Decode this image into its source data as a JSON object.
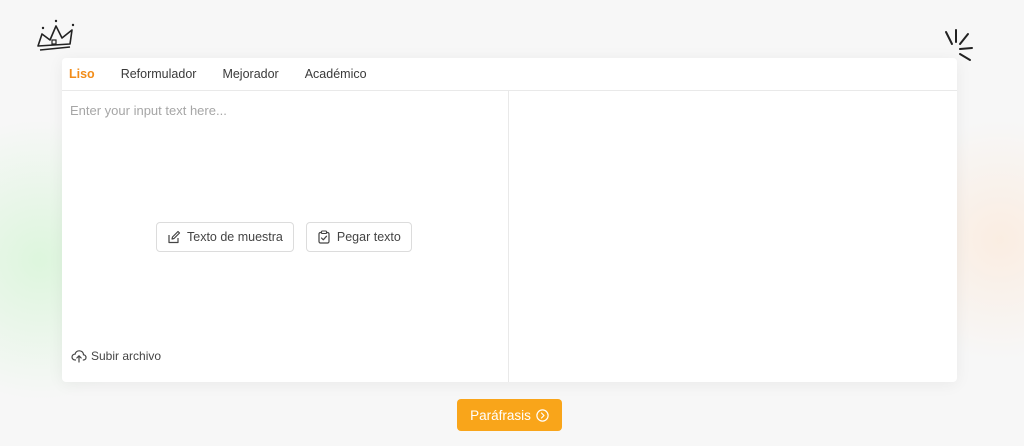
{
  "tabs": [
    {
      "label": "Liso",
      "active": true
    },
    {
      "label": "Reformulador",
      "active": false
    },
    {
      "label": "Mejorador",
      "active": false
    },
    {
      "label": "Académico",
      "active": false
    }
  ],
  "input": {
    "value": "",
    "placeholder": "Enter your input text here..."
  },
  "actions": {
    "sample_label": "Texto de muestra",
    "paste_label": "Pegar texto",
    "upload_label": "Subir archivo"
  },
  "submit": {
    "label": "Paráfrasis"
  },
  "colors": {
    "accent": "#f28c18",
    "button": "#f9a51a",
    "background": "#f7f7f7"
  },
  "icons": {
    "crown": "crown-doodle-icon",
    "rays": "sparkle-rays-icon",
    "sample": "edit-note-icon",
    "paste": "clipboard-check-icon",
    "upload": "cloud-upload-icon",
    "submit": "chevron-circle-right-icon"
  }
}
